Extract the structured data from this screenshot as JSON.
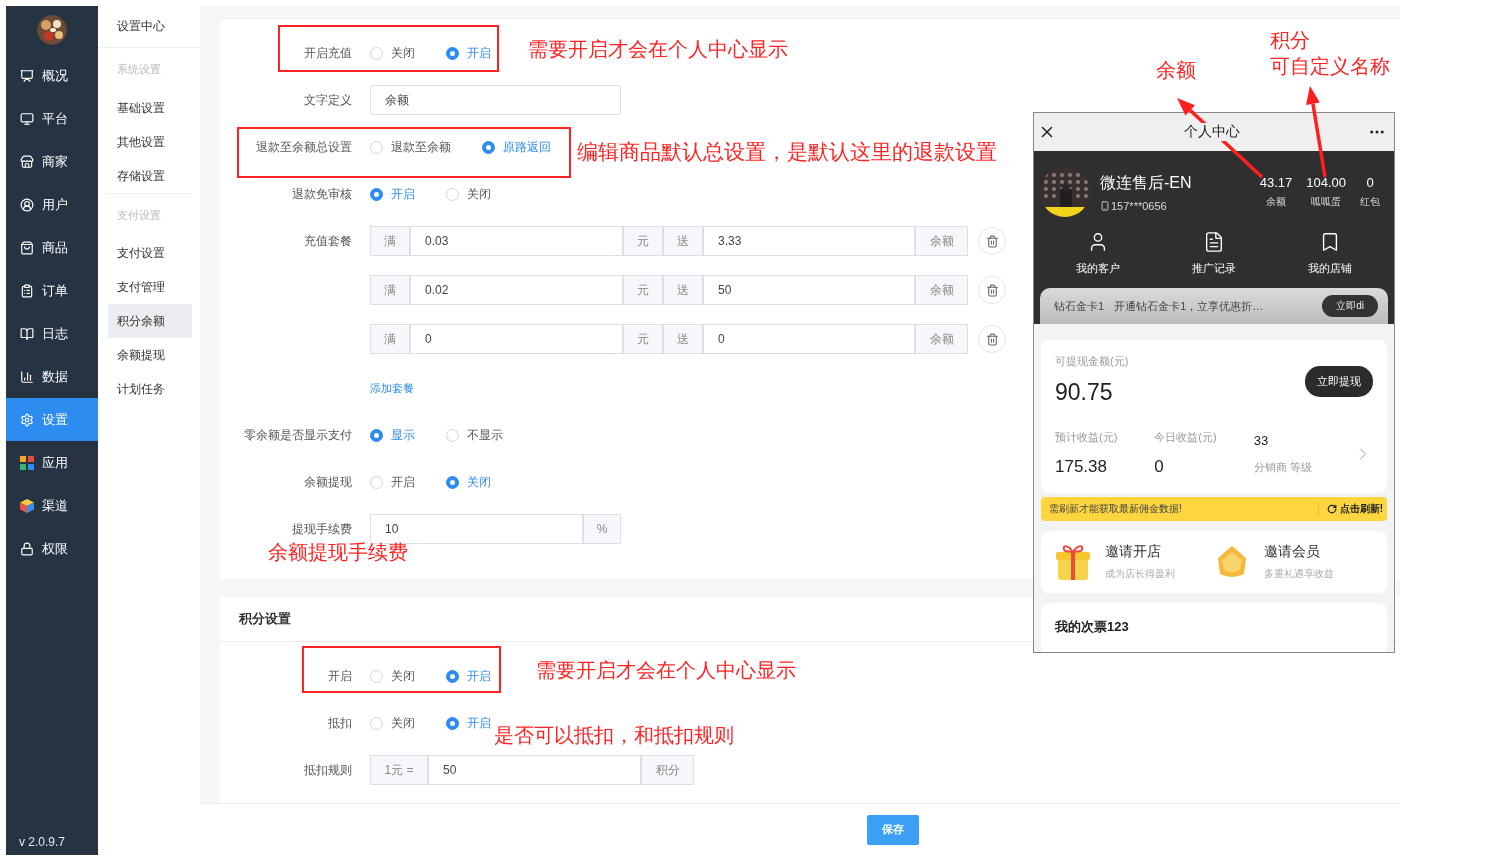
{
  "sidebar": {
    "items": [
      {
        "label": "概况",
        "selected": false
      },
      {
        "label": "平台",
        "selected": false
      },
      {
        "label": "商家",
        "selected": false
      },
      {
        "label": "用户",
        "selected": false
      },
      {
        "label": "商品",
        "selected": false
      },
      {
        "label": "订单",
        "selected": false
      },
      {
        "label": "日志",
        "selected": false
      },
      {
        "label": "数据",
        "selected": false
      },
      {
        "label": "设置",
        "selected": true
      },
      {
        "label": "应用",
        "selected": false
      },
      {
        "label": "渠道",
        "selected": false
      },
      {
        "label": "权限",
        "selected": false
      }
    ],
    "version": "v 2.0.9.7"
  },
  "submenu": {
    "title": "设置中心",
    "groups": [
      {
        "heading": "系统设置",
        "items": [
          {
            "label": "基础设置",
            "selected": false
          },
          {
            "label": "其他设置",
            "selected": false
          },
          {
            "label": "存储设置",
            "selected": false
          }
        ]
      },
      {
        "heading": "支付设置",
        "items": [
          {
            "label": "支付设置",
            "selected": false
          },
          {
            "label": "支付管理",
            "selected": false
          },
          {
            "label": "积分余额",
            "selected": true
          },
          {
            "label": "余额提现",
            "selected": false
          },
          {
            "label": "计划任务",
            "selected": false
          }
        ]
      }
    ]
  },
  "balance_settings": {
    "rows": [
      {
        "kind": "radio",
        "label": "开启充值",
        "options": [
          {
            "label": "关闭",
            "selected": false
          },
          {
            "label": "开启",
            "selected": true
          }
        ]
      },
      {
        "kind": "input",
        "label": "文字定义",
        "value": "余额"
      },
      {
        "kind": "radio",
        "label": "退款至余额总设置",
        "options": [
          {
            "label": "退款至余额",
            "selected": false
          },
          {
            "label": "原路返回",
            "selected": true
          }
        ]
      },
      {
        "kind": "radio",
        "label": "退款免审核",
        "options": [
          {
            "label": "开启",
            "selected": true
          },
          {
            "label": "关闭",
            "selected": false
          }
        ]
      },
      {
        "kind": "packages",
        "label": "充值套餐",
        "add_link": "添加套餐",
        "items": [
          {
            "prefix": "满",
            "amount": "0.03",
            "unit": "元",
            "give": "送",
            "bonus": "3.33",
            "suffix": "余额"
          },
          {
            "prefix": "满",
            "amount": "0.02",
            "unit": "元",
            "give": "送",
            "bonus": "50",
            "suffix": "余额"
          },
          {
            "prefix": "满",
            "amount": "0",
            "unit": "元",
            "give": "送",
            "bonus": "0",
            "suffix": "余额"
          }
        ]
      },
      {
        "kind": "radio",
        "label": "零余额是否显示支付",
        "options": [
          {
            "label": "显示",
            "selected": true
          },
          {
            "label": "不显示",
            "selected": false
          }
        ]
      },
      {
        "kind": "radio",
        "label": "余额提现",
        "options": [
          {
            "label": "开启",
            "selected": false
          },
          {
            "label": "关闭",
            "selected": true
          }
        ]
      },
      {
        "kind": "addon_input",
        "label": "提现手续费",
        "value": "10",
        "suffix": "%"
      }
    ]
  },
  "points_settings": {
    "title": "积分设置",
    "rows": [
      {
        "kind": "radio",
        "label": "开启",
        "options": [
          {
            "label": "关闭",
            "selected": false
          },
          {
            "label": "开启",
            "selected": true
          }
        ]
      },
      {
        "kind": "radio",
        "label": "抵扣",
        "options": [
          {
            "label": "关闭",
            "selected": false
          },
          {
            "label": "开启",
            "selected": true
          }
        ]
      },
      {
        "kind": "addon_input",
        "label": "抵扣规则",
        "prefix": "1元 =",
        "value": "50",
        "suffix": "积分"
      }
    ]
  },
  "save_button": "保存",
  "phone": {
    "title": "个人中心",
    "profile": {
      "name": "微连售后-EN",
      "phone": "157***0656",
      "stats": [
        {
          "value": "43.17",
          "label": "余额"
        },
        {
          "value": "104.00",
          "label": "呱呱蛋"
        },
        {
          "value": "0",
          "label": "红包"
        }
      ]
    },
    "shortcuts": [
      "我的客户",
      "推广记录",
      "我的店铺"
    ],
    "membership": {
      "name": "钻石金卡1",
      "text": "开通钻石金卡1，立享优惠折…",
      "button": "立即di"
    },
    "withdraw": {
      "label": "可提现金额(元)",
      "amount": "90.75",
      "button": "立即提现",
      "stats": [
        {
          "label": "预计收益(元)",
          "value": "175.38"
        },
        {
          "label": "今日收益(元)",
          "value": "0"
        }
      ],
      "rank": {
        "value": "33",
        "label": "分销商 等级"
      }
    },
    "notice": {
      "text": "需刷新才能获取最新佣金数据!",
      "action": "点击刷新!"
    },
    "invites": [
      {
        "title": "邀请开店",
        "subtitle": "成为店长得盈利"
      },
      {
        "title": "邀请会员",
        "subtitle": "多重礼遇享收益"
      }
    ],
    "section_title": "我的次票123"
  },
  "annotations": [
    {
      "text": "需要开启才会在个人中心显示"
    },
    {
      "text": "编辑商品默认总设置，是默认这里的退款设置"
    },
    {
      "text": "余额提现手续费"
    },
    {
      "text": "需要开启才会在个人中心显示"
    },
    {
      "text": "是否可以抵扣，和抵扣规则"
    },
    {
      "text": "余额"
    },
    {
      "text": "积分"
    },
    {
      "text": "可自定义名称"
    }
  ]
}
